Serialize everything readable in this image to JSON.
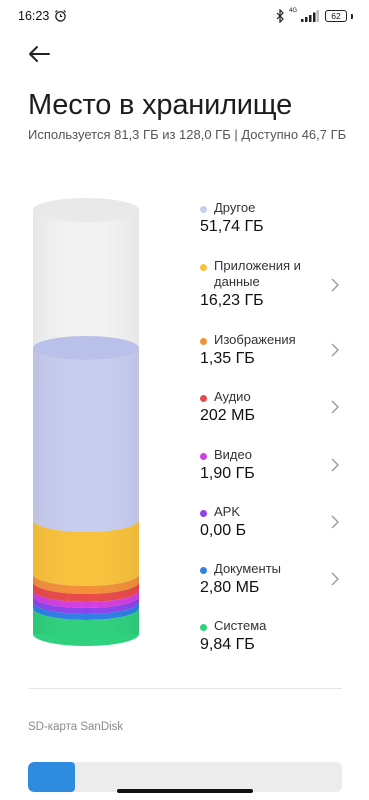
{
  "status_bar": {
    "time": "16:23",
    "network_label": "4G",
    "battery": "62"
  },
  "header": {
    "title": "Место в хранилище",
    "usage_summary": "Используется 81,3 ГБ из 128,0 ГБ | Доступно 46,7 ГБ"
  },
  "categories": [
    {
      "label": "Другое",
      "value": "51,74 ГБ",
      "color": "#c8cdf0"
    },
    {
      "label": "Приложения и данные",
      "value": "16,23 ГБ",
      "color": "#f9c23c"
    },
    {
      "label": "Изображения",
      "value": "1,35 ГБ",
      "color": "#f2903a"
    },
    {
      "label": "Аудио",
      "value": "202 МБ",
      "color": "#e94a4a"
    },
    {
      "label": "Видео",
      "value": "1,90 ГБ",
      "color": "#d33ee0"
    },
    {
      "label": "APK",
      "value": "0,00 Б",
      "color": "#8e44ec"
    },
    {
      "label": "Документы",
      "value": "2,80 МБ",
      "color": "#2f7fe6"
    },
    {
      "label": "Система",
      "value": "9,84 ГБ",
      "color": "#2fd07e"
    }
  ],
  "sd_card": {
    "label": "SD-карта SanDisk",
    "used_fraction": 0.15,
    "accent": "#2f8be0"
  }
}
